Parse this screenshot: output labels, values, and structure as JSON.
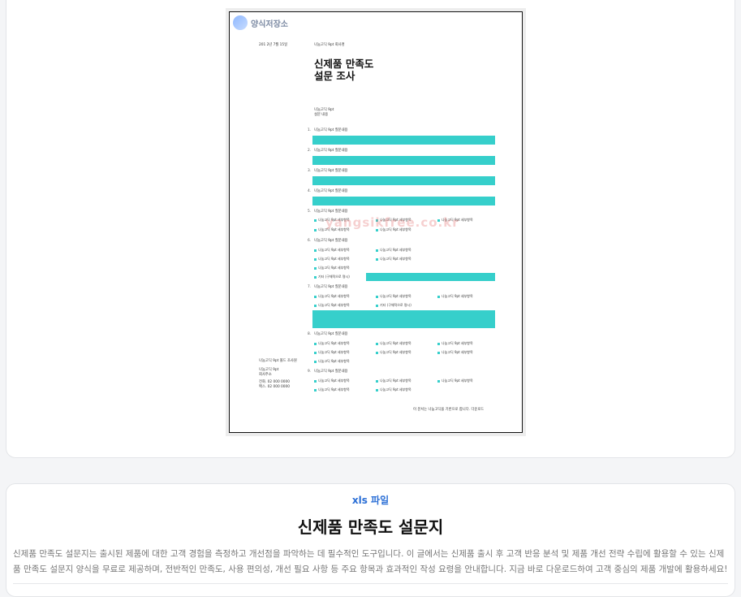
{
  "preview": {
    "logo": "양식저장소",
    "date": "201 2년 7월 15일",
    "org": "나눔고딕 9pt 회사명",
    "title_line1": "신제품 만족도",
    "title_line2": "설문 조사",
    "intro_line1": "나눔고딕 9pt",
    "intro_line2": "설문 내용",
    "question": "나눔고딕 9pt 질문내용",
    "option": "나눔고딕 9pt 세부항목",
    "option_other": "기타 (구체적으로 명시)",
    "sidebar_line1": "나눔고딕 9pt 볼드 조사원",
    "sidebar_line2": "나눔고딕 9pt",
    "sidebar_line3": "회사주소",
    "sidebar_line4": "전화. 02 000 0000",
    "sidebar_line5": "팩스. 02 000 0000",
    "footer": "이 문서는 나눔고딕을 기반으로 합니다. 다운로드",
    "watermark": "yangsikfree.co.kr",
    "q_numbers": [
      "1.",
      "2.",
      "3.",
      "4.",
      "5.",
      "6.",
      "7.",
      "8.",
      "9."
    ]
  },
  "info": {
    "file_type": "xls 파일",
    "title": "신제품 만족도 설문지",
    "description": "신제품 만족도 설문지는 출시된 제품에 대한 고객 경험을 측정하고 개선점을 파악하는 데 필수적인 도구입니다. 이 글에서는 신제품 출시 후 고객 반응 분석 및 제품 개선 전략 수립에 활용할 수 있는 신제품 만족도 설문지 양식을 무료로 제공하며, 전반적인 만족도, 사용 편의성, 개선 필요 사항 등 주요 항목과 효과적인 작성 요령을 안내합니다. 지금 바로 다운로드하여 고객 중심의 제품 개발에 활용하세요!"
  },
  "colors": {
    "accent_bar": "#36cfcb",
    "file_type": "#2b6fd6"
  }
}
